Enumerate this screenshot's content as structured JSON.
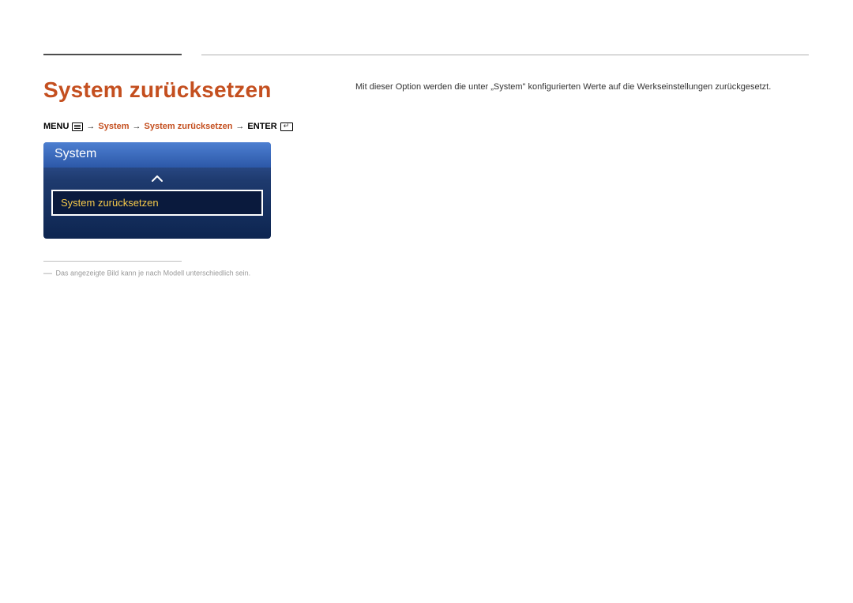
{
  "heading": "System zurücksetzen",
  "breadcrumb": {
    "menu_label": "MENU",
    "system": "System",
    "system_reset": "System zurücksetzen",
    "enter_label": "ENTER"
  },
  "panel": {
    "title": "System",
    "item": "System zurücksetzen"
  },
  "footnote": "Das angezeigte Bild kann je nach Modell unterschiedlich sein.",
  "description": "Mit dieser Option werden die unter „System\" konfigurierten Werte auf die Werkseinstellungen zurückgesetzt."
}
